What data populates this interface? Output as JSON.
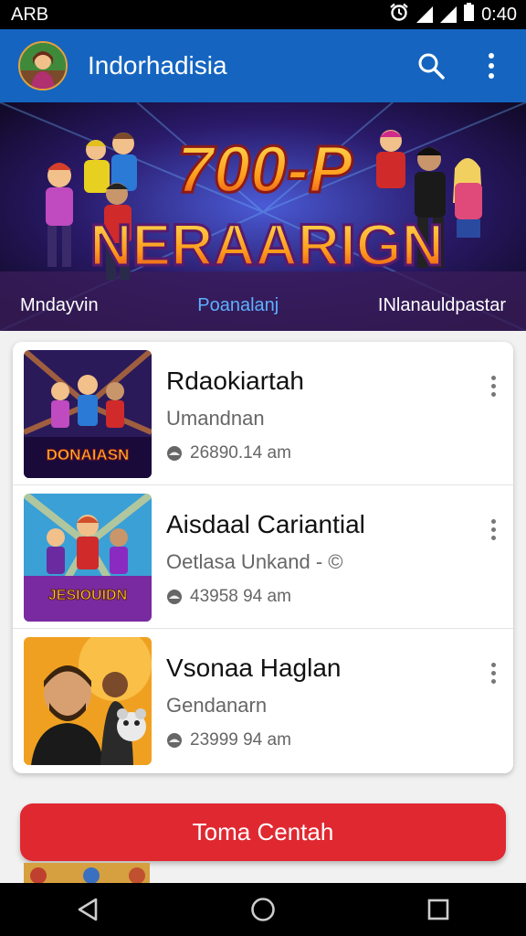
{
  "status_bar": {
    "left_text": "ARB",
    "time": "0:40"
  },
  "app_bar": {
    "title": "Indorhadisia"
  },
  "banner": {
    "headline_top": "700-P",
    "headline_bottom": "NERAARIGN",
    "tabs": [
      {
        "label": "Mndayvin",
        "active": false
      },
      {
        "label": "Poanalanj",
        "active": true
      },
      {
        "label": "INlanauldpastar",
        "active": false
      }
    ]
  },
  "list": [
    {
      "title": "Rdaokiartah",
      "subtitle": "Umandnan",
      "meta": "26890.14 am",
      "thumb_text": "DONAIASN"
    },
    {
      "title": "Aisdaal Cariantial",
      "subtitle": "Oetlasa Unkand - ©",
      "meta": "43958 94 am",
      "thumb_text": "JESIOUIDN"
    },
    {
      "title": "Vsonaa Haglan",
      "subtitle": "Gendanarn",
      "meta": "23999 94 am",
      "thumb_text": ""
    }
  ],
  "primary_button": {
    "label": "Toma Centah"
  },
  "colors": {
    "app_bar": "#1565c0",
    "primary": "#e02831",
    "tab_active": "#5cb0ff"
  },
  "icons": [
    "search-icon",
    "more-vert-icon",
    "alarm-icon",
    "signal-icon",
    "back-icon",
    "home-icon",
    "recents-icon"
  ]
}
